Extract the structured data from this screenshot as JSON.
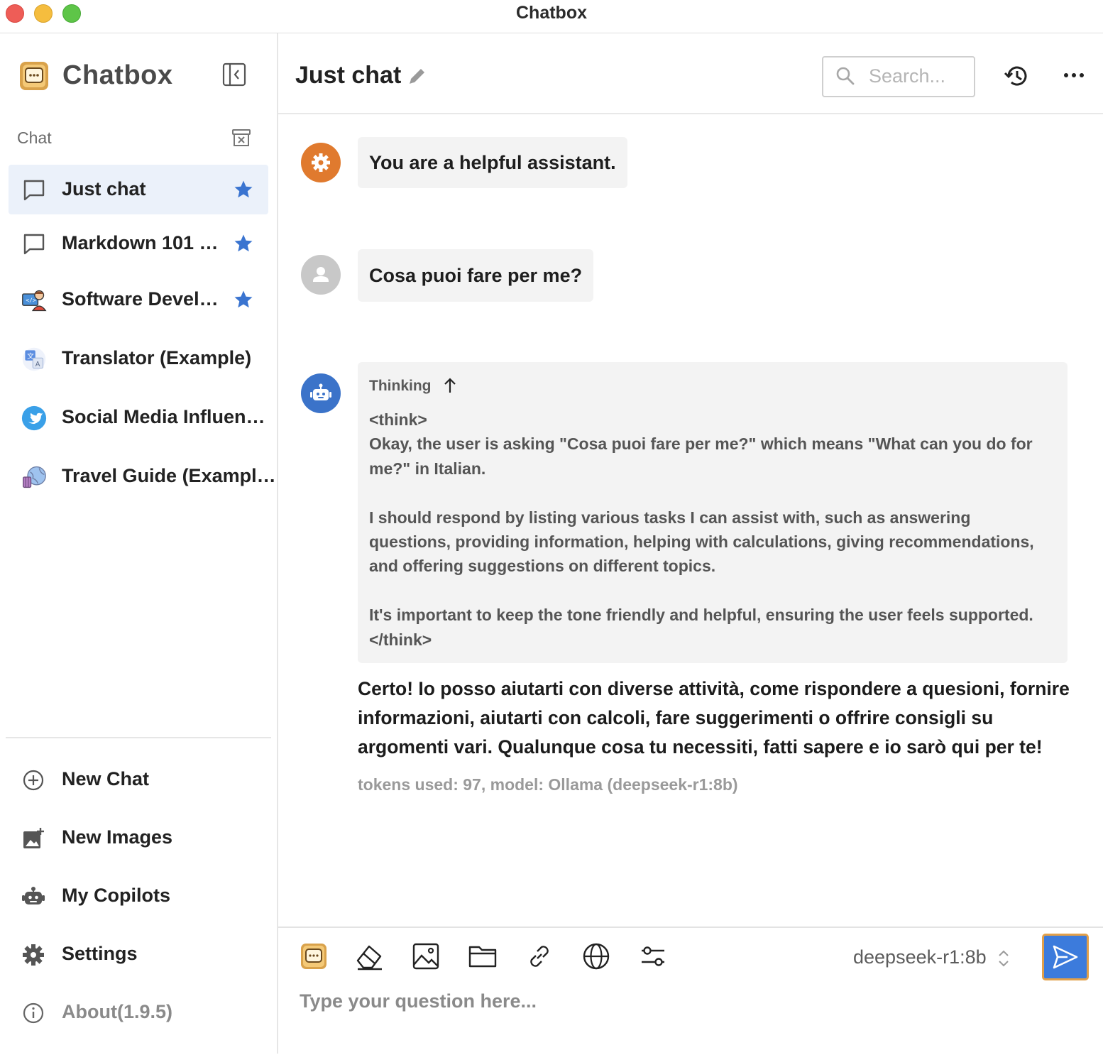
{
  "window": {
    "title": "Chatbox"
  },
  "sidebar": {
    "brand": "Chatbox",
    "section_label": "Chat",
    "sessions": [
      {
        "name": "Just chat",
        "starred": true,
        "active": true,
        "icon": "chat-bubble-icon"
      },
      {
        "name": "Markdown 101 …",
        "starred": true,
        "active": false,
        "icon": "chat-bubble-icon"
      },
      {
        "name": "Software Devel…",
        "starred": true,
        "active": false,
        "icon": "developer-avatar-icon"
      },
      {
        "name": "Translator (Example)",
        "starred": false,
        "active": false,
        "icon": "translate-icon"
      },
      {
        "name": "Social Media Influen…",
        "starred": false,
        "active": false,
        "icon": "twitter-icon"
      },
      {
        "name": "Travel Guide (Exampl…",
        "starred": false,
        "active": false,
        "icon": "globe-travel-icon"
      }
    ],
    "nav": {
      "new_chat": "New Chat",
      "new_images": "New Images",
      "my_copilots": "My Copilots",
      "settings": "Settings",
      "about": "About(1.9.5)"
    }
  },
  "header": {
    "title": "Just chat",
    "search_placeholder": "Search..."
  },
  "messages": {
    "system": "You are a helpful assistant.",
    "user": "Cosa puoi fare per me?",
    "assistant": {
      "thinking_label": "Thinking",
      "thinking_text": "<think>\nOkay, the user is asking \"Cosa puoi fare per me?\" which means \"What can you do for me?\" in Italian.\n\nI should respond by listing various tasks I can assist with, such as answering questions, providing information, helping with calculations, giving recommendations, and offering suggestions on different topics.\n\nIt's important to keep the tone friendly and helpful, ensuring the user feels supported.\n</think>",
      "answer": "Certo! Io posso aiutarti con diverse attività, come rispondere a quesioni, fornire informazioni, aiutarti con calcoli, fare suggerimenti o offrire consigli su argomenti vari. Qualunque cosa tu necessiti, fatti sapere e io sarò qui per te!",
      "meta": "tokens used: 97, model: Ollama (deepseek-r1:8b)"
    }
  },
  "composer": {
    "model": "deepseek-r1:8b",
    "placeholder": "Type your question here..."
  },
  "colors": {
    "accent": "#3c7bdc",
    "system_avatar": "#e07a2e",
    "user_avatar": "#c8c8c8",
    "assistant_avatar": "#3b73c9",
    "active_session_bg": "#ebf1fa",
    "star": "#3a74d0"
  }
}
